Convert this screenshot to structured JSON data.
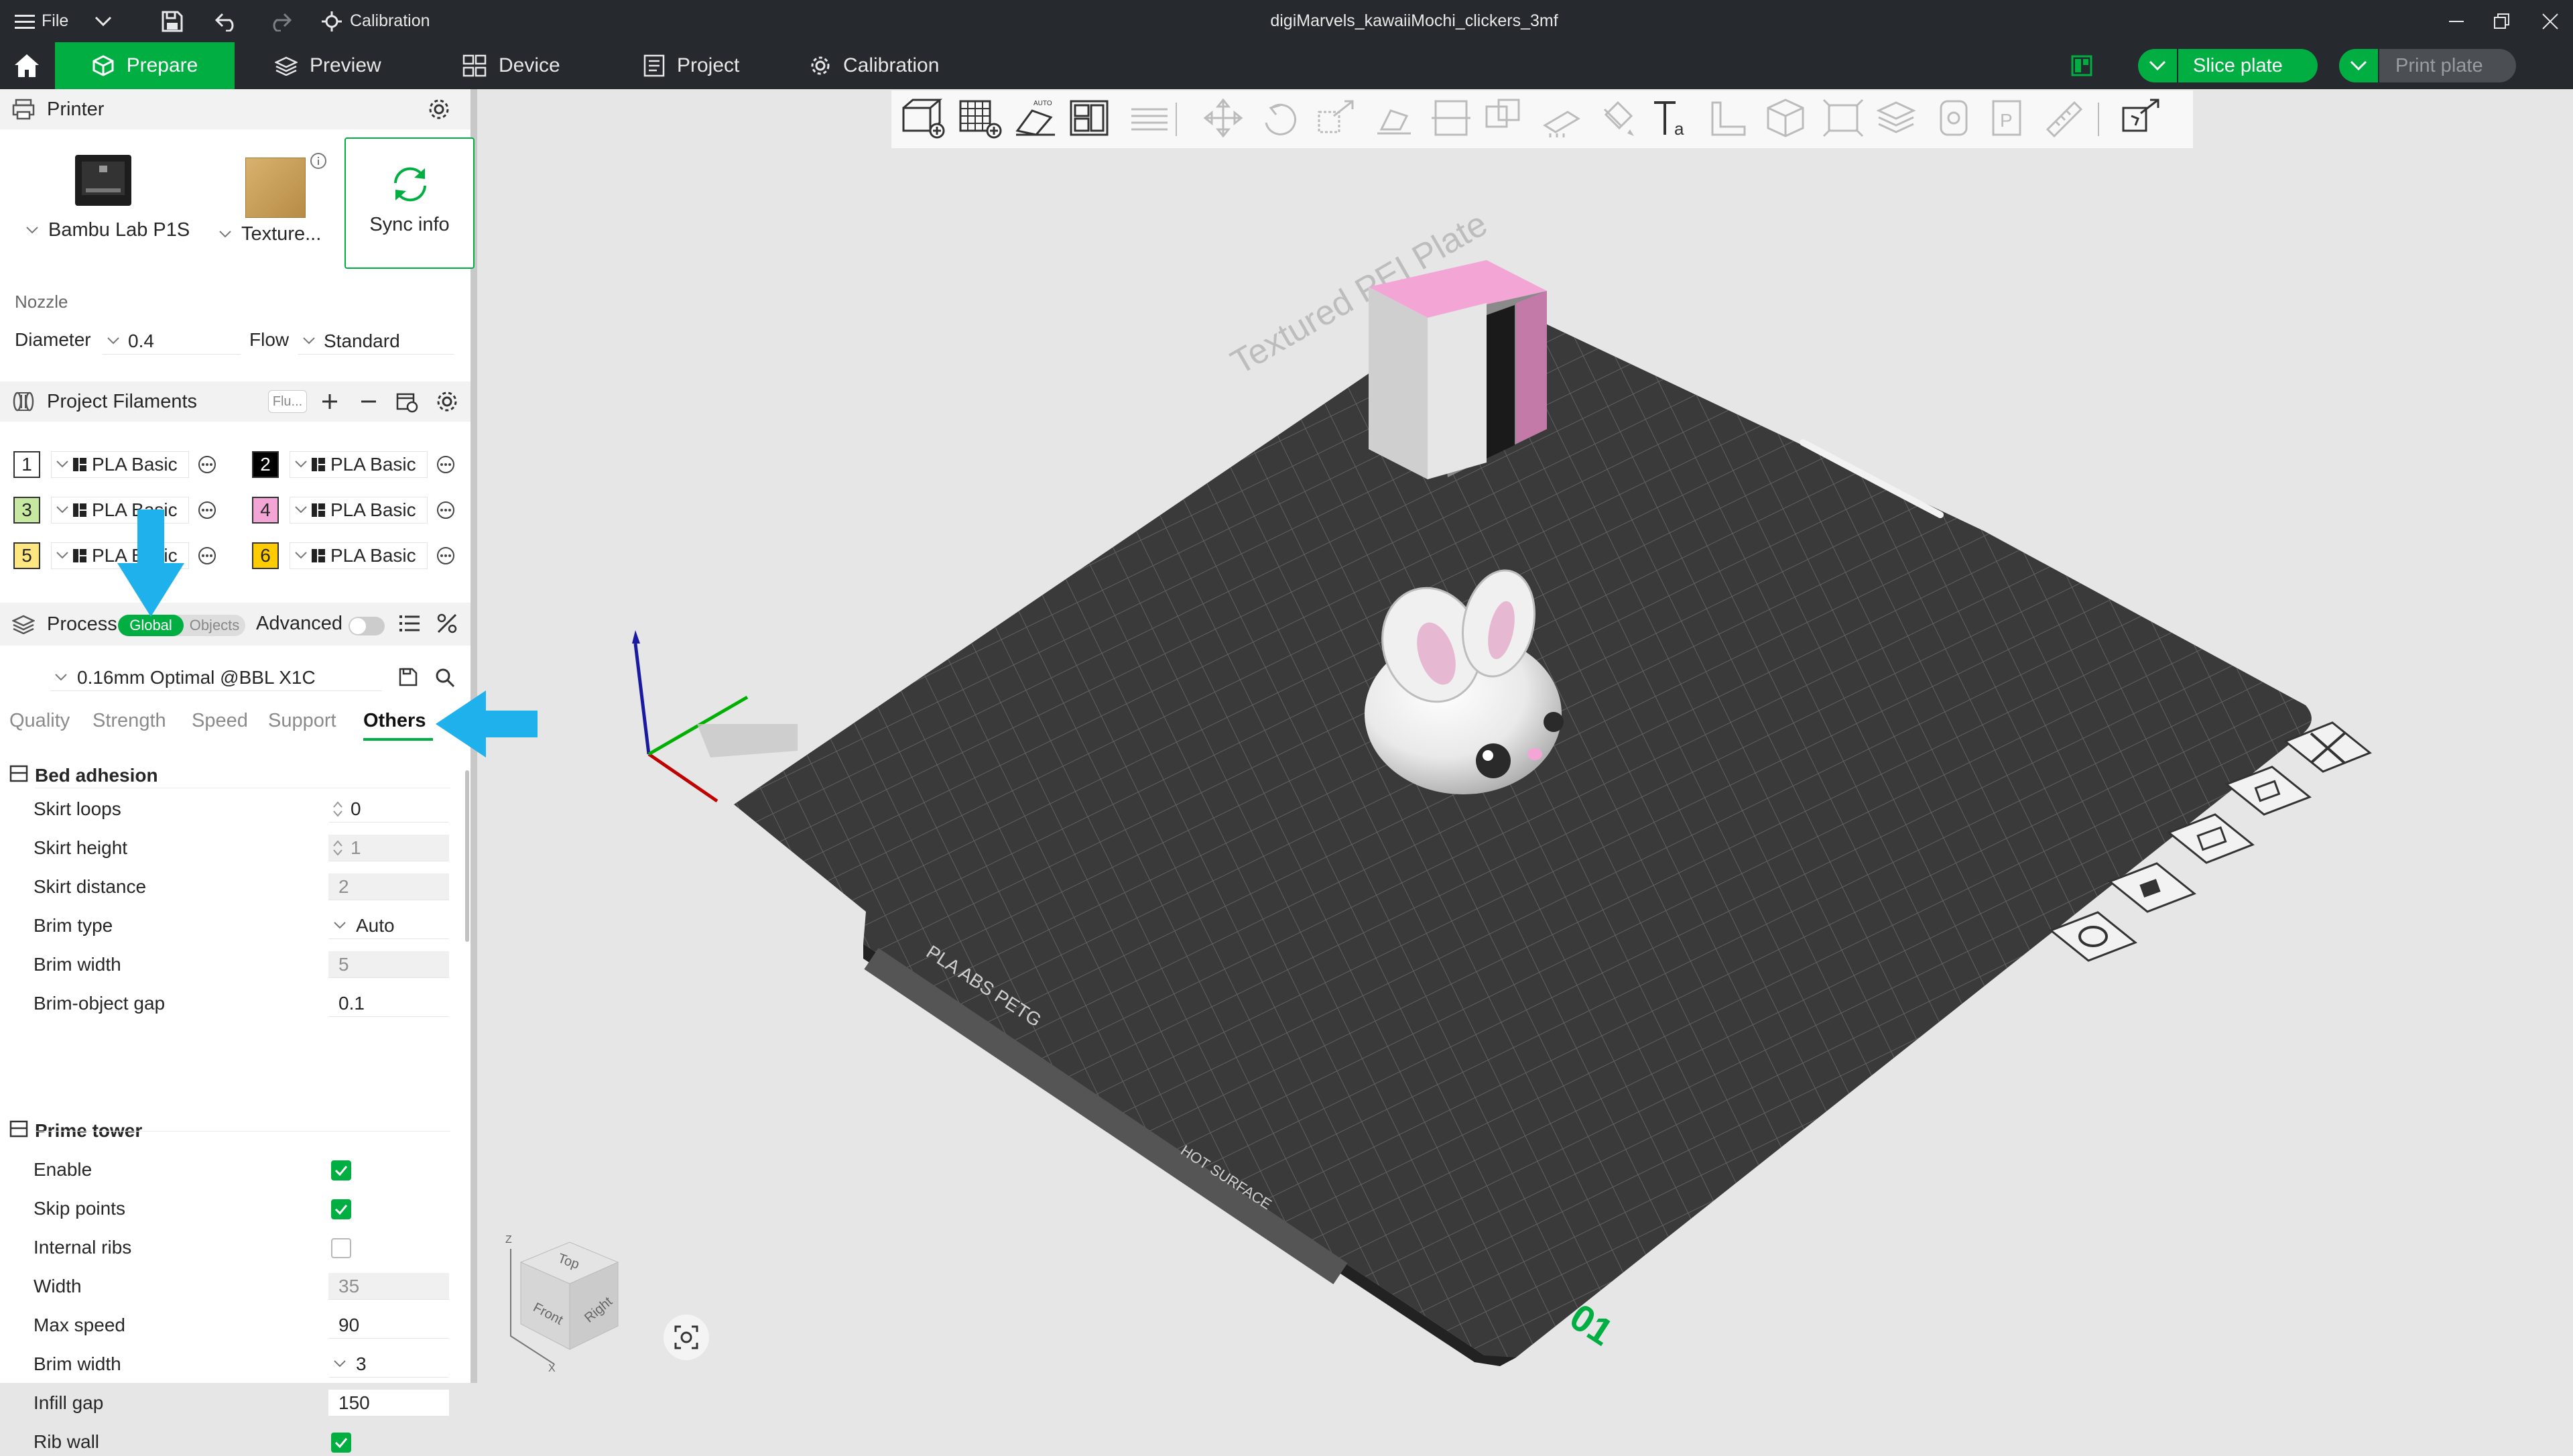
{
  "titlebar": {
    "file_label": "File",
    "calibration_label": "Calibration",
    "document_title": "digiMarvels_kawaiiMochi_clickers_3mf"
  },
  "topnav": {
    "tabs": [
      {
        "label": "Prepare"
      },
      {
        "label": "Preview"
      },
      {
        "label": "Device"
      },
      {
        "label": "Project"
      },
      {
        "label": "Calibration"
      }
    ],
    "slice_label": "Slice plate",
    "print_label": "Print plate"
  },
  "printer": {
    "header": "Printer",
    "printer_name": "Bambu Lab P1S",
    "plate_name": "Texture...",
    "sync_label": "Sync info",
    "nozzle_label": "Nozzle",
    "diameter_label": "Diameter",
    "diameter_value": "0.4",
    "flow_label": "Flow",
    "flow_value": "Standard"
  },
  "filaments": {
    "header": "Project Filaments",
    "flush_label": "Flu...",
    "items": [
      {
        "num": "1",
        "name": "PLA Basic",
        "color": "#ffffff",
        "text": "#262626"
      },
      {
        "num": "2",
        "name": "PLA Basic",
        "color": "#000000",
        "text": "#ffffff"
      },
      {
        "num": "3",
        "name": "PLA Basic",
        "color": "#c6e8a0",
        "text": "#262626"
      },
      {
        "num": "4",
        "name": "PLA Basic",
        "color": "#f3a6d6",
        "text": "#262626"
      },
      {
        "num": "5",
        "name": "PLA Basic",
        "color": "#ffe680",
        "text": "#262626"
      },
      {
        "num": "6",
        "name": "PLA Basic",
        "color": "#ffcc00",
        "text": "#262626"
      }
    ]
  },
  "process": {
    "header": "Process",
    "global_label": "Global",
    "objects_label": "Objects",
    "advanced_label": "Advanced",
    "preset": "0.16mm Optimal @BBL X1C",
    "tabs": [
      "Quality",
      "Strength",
      "Speed",
      "Support",
      "Others"
    ],
    "active_tab": "Others",
    "bed_adhesion": {
      "title": "Bed adhesion",
      "rows": [
        {
          "label": "Skirt loops",
          "value": "0"
        },
        {
          "label": "Skirt height",
          "value": "1"
        },
        {
          "label": "Skirt distance",
          "value": "2"
        },
        {
          "label": "Brim type",
          "value": "Auto"
        },
        {
          "label": "Brim width",
          "value": "5"
        },
        {
          "label": "Brim-object gap",
          "value": "0.1"
        }
      ]
    },
    "prime_tower": {
      "title": "Prime tower",
      "rows": [
        {
          "label": "Enable"
        },
        {
          "label": "Skip points"
        },
        {
          "label": "Internal ribs"
        },
        {
          "label": "Width",
          "value": "35"
        },
        {
          "label": "Max speed",
          "value": "90"
        },
        {
          "label": "Brim width",
          "value": "3"
        },
        {
          "label": "Infill gap",
          "value": "150"
        },
        {
          "label": "Rib wall"
        }
      ]
    }
  },
  "viewport": {
    "bed_label": "Textured PEI Plate",
    "bed_material": "PLA ABS PETG",
    "hot_surface": "HOT SURFACE",
    "plate_number": "01",
    "cube_top": "Top",
    "cube_front": "Front",
    "cube_right": "Right",
    "axis_z": "Z",
    "axis_x": "X",
    "toolbar_auto": "AUTO"
  },
  "colors": {
    "accent": "#00ae42",
    "topbar": "#262a2f",
    "arrow_callout": "#1eb1ec"
  }
}
